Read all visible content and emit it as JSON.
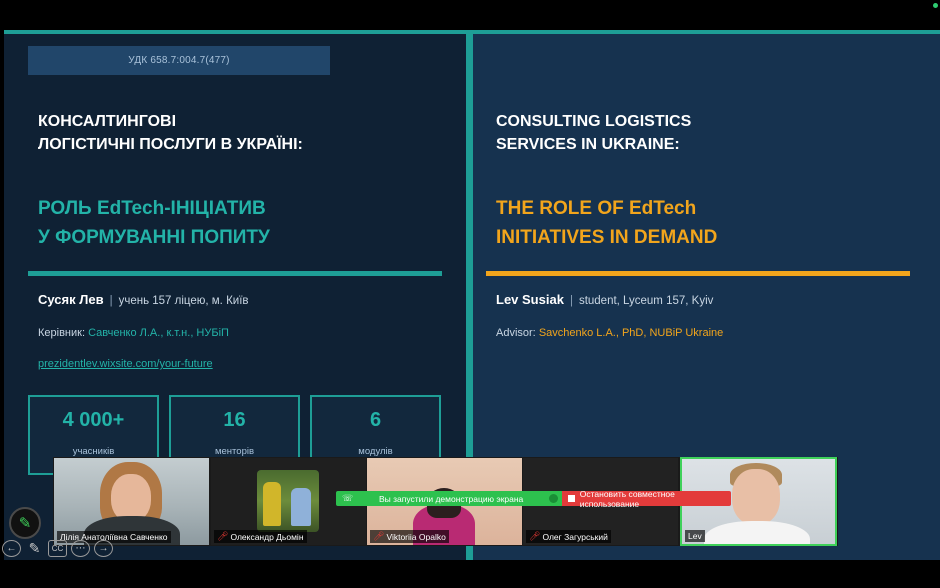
{
  "slide": {
    "udk": "УДК 658.7:004.7(477)",
    "left": {
      "title_line1": "КОНСАЛТИНГОВІ",
      "title_line2": "ЛОГІСТИЧНІ ПОСЛУГИ В УКРАЇНІ:",
      "subtitle_line1": "РОЛЬ EdTech-ІНІЦІАТИВ",
      "subtitle_line2": "У ФОРМУВАННІ ПОПИТУ",
      "author_name": "Сусяк Лев",
      "author_role": "учень 157 ліцею, м. Київ",
      "advisor_label": "Керівник:",
      "advisor_value": "Савченко Л.А., к.т.н., НУБіП",
      "link": "prezidentlev.wixsite.com/your-future",
      "stats": [
        {
          "number": "4 000+",
          "label": "учасників"
        },
        {
          "number": "16",
          "label": "менторів"
        },
        {
          "number": "6",
          "label": "модулів"
        }
      ]
    },
    "right": {
      "title_line1": "CONSULTING LOGISTICS",
      "title_line2": "SERVICES IN UKRAINE:",
      "subtitle_line1": "THE ROLE OF EdTech",
      "subtitle_line2": "INITIATIVES IN DEMAND",
      "author_name": "Lev Susiak",
      "author_role": "student, Lyceum 157, Kyiv",
      "advisor_label": "Advisor:",
      "advisor_value": "Savchenko L.A., PhD, NUBiP Ukraine"
    },
    "separator": "|"
  },
  "participants": [
    {
      "name": "Лілія Анатоліївна Савченко",
      "muted": false
    },
    {
      "name": "Олександр Дьомін",
      "muted": true
    },
    {
      "name": "Viktoriia Opalko",
      "muted": true
    },
    {
      "name": "Олег Загурський",
      "muted": true
    },
    {
      "name": "Lev",
      "muted": false
    }
  ],
  "share_banner": {
    "message": "Вы запустили демонстрацию экрана",
    "stop_label": "Остановить совместное использование"
  },
  "controls": {
    "pen": "✎",
    "back": "←",
    "draw": "✎",
    "cc": "CC",
    "more": "⋯",
    "forward": "→"
  },
  "colors": {
    "teal": "#23b3a8",
    "orange": "#f2a51c",
    "active_speaker": "#3fd15a",
    "share_green": "#2dc14e",
    "share_red": "#e33b3b"
  }
}
